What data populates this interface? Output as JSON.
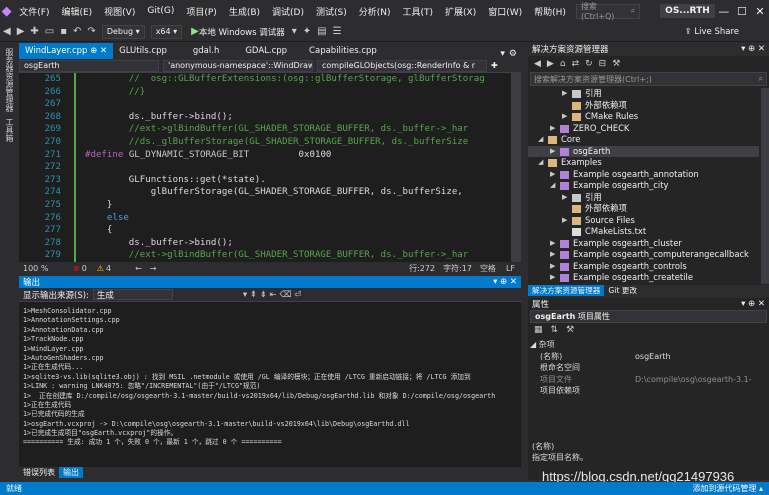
{
  "menu": {
    "items": [
      "文件(F)",
      "编辑(E)",
      "视图(V)",
      "Git(G)",
      "项目(P)",
      "生成(B)",
      "调试(D)",
      "测试(S)",
      "分析(N)",
      "工具(T)",
      "扩展(X)",
      "窗口(W)",
      "帮助(H)"
    ],
    "search_placeholder": "搜索 (Ctrl+Q)",
    "project_badge": "OS...RTH",
    "minimize": "—",
    "maximize": "☐",
    "close": "✕"
  },
  "toolbar": {
    "config": "Debug",
    "platform": "x64",
    "run_label": "本地 Windows 调试器",
    "live_share": "Live Share"
  },
  "left_strip": {
    "labels": [
      "服务器资源管理器",
      "工具箱"
    ]
  },
  "tabs": [
    {
      "label": "WindLayer.cpp",
      "active": false
    },
    {
      "label": "GLUtils.cpp",
      "active": false
    },
    {
      "label": "gdal.h",
      "active": false
    },
    {
      "label": "GDAL.cpp",
      "active": false
    },
    {
      "label": "Capabilities.cpp",
      "active": false
    }
  ],
  "navbar": {
    "project": "osgEarth",
    "scope": "'anonymous-namespace'::WindDrawab",
    "member": "compileGLObjects(osg::RenderInfo & r"
  },
  "code": [
    {
      "n": "265",
      "segs": [
        {
          "t": "        //  osg::GLBufferExtensions:(osg::glBufferStorage, glBufferStorag",
          "c": "c-cm"
        }
      ]
    },
    {
      "n": "266",
      "segs": [
        {
          "t": "        //}",
          "c": "c-cm"
        }
      ]
    },
    {
      "n": "267",
      "segs": [
        {
          "t": "",
          "c": "c-id"
        }
      ]
    },
    {
      "n": "268",
      "segs": [
        {
          "t": "        ds._buffer->bind();",
          "c": "c-id"
        }
      ]
    },
    {
      "n": "269",
      "segs": [
        {
          "t": "        //ext->glBindBuffer(GL_SHADER_STORAGE_BUFFER, ds._buffer->_har",
          "c": "c-cm"
        }
      ]
    },
    {
      "n": "270",
      "segs": [
        {
          "t": "        //ds._glBufferStorage(GL_SHADER_STORAGE_BUFFER, ds._bufferSize",
          "c": "c-cm"
        }
      ]
    },
    {
      "n": "271",
      "segs": [
        {
          "t": "#define ",
          "c": "c-mac"
        },
        {
          "t": "GL_DYNAMIC_STORAGE_BIT",
          "c": "c-macn"
        },
        {
          "t": "         0x0100",
          "c": "c-id"
        }
      ]
    },
    {
      "n": "272",
      "segs": [
        {
          "t": "",
          "c": "c-id"
        }
      ]
    },
    {
      "n": "273",
      "segs": [
        {
          "t": "        GLFunctions::get(*state).",
          "c": "c-id"
        }
      ]
    },
    {
      "n": "274",
      "segs": [
        {
          "t": "            glBufferStorage(GL_SHADER_STORAGE_BUFFER, ds._bufferSize,",
          "c": "c-id"
        }
      ]
    },
    {
      "n": "275",
      "segs": [
        {
          "t": "    }",
          "c": "c-id"
        }
      ]
    },
    {
      "n": "276",
      "segs": [
        {
          "t": "    else",
          "c": "c-kw"
        }
      ]
    },
    {
      "n": "277",
      "segs": [
        {
          "t": "    {",
          "c": "c-id"
        }
      ]
    },
    {
      "n": "278",
      "segs": [
        {
          "t": "        ds._buffer->bind();",
          "c": "c-id"
        }
      ]
    },
    {
      "n": "279",
      "segs": [
        {
          "t": "        //ext->glBindBuffer(GL_SHADER_STORAGE_BUFFER, ds._buffer->_har",
          "c": "c-cm"
        }
      ]
    }
  ],
  "editor_status": {
    "zoom": "100 %",
    "errors": "0",
    "warnings": "4",
    "line": "行:272",
    "char": "字符:17",
    "ws": "空格",
    "eol": "LF"
  },
  "output": {
    "title": "输出",
    "source_label": "显示输出来源(S):",
    "source_value": "生成",
    "lines": [
      "1>MeshConsolidator.cpp",
      "1>AnnotationSettings.cpp",
      "1>AnnotationData.cpp",
      "1>TrackNode.cpp",
      "1>WindLayer.cpp",
      "1>AutoGenShaders.cpp",
      "1>正在生成代码...",
      "1>sqlite3-vs.lib(sqlite3.obj) : 找到 MSIL .netmodule 或使用 /GL 编译的模块；正在使用 /LTCG 重新启动链接；将 /LTCG 添加到",
      "1>LINK : warning LNK4075: 忽略\"/INCREMENTAL\"(由于\"/LTCG\"规范)",
      "1>  正在创建库 D:/compile/osg/osgearth-3.1-master/build-vs2019x64/lib/Debug/osgEarthd.lib 和对象 D:/compile/osg/osgearth",
      "1>正在生成代码",
      "1>已完成代码的生成",
      "1>osgEarth.vcxproj -> D:\\compile\\osg\\osgearth-3.1-master\\build-vs2019x64\\lib\\Debug\\osgEarthd.dll",
      "1>已完成生成项目\"osgEarth.vcxproj\"的操作。",
      "========== 生成: 成功 1 个，失败 0 个，最新 1 个，跳过 0 个 =========="
    ]
  },
  "bottom_tabs": [
    "错误列表",
    "输出"
  ],
  "solution": {
    "title": "解决方案资源管理器",
    "search_placeholder": "搜索解决方案资源管理器(Ctrl+;)",
    "tree": [
      {
        "label": "引用",
        "indent": 3,
        "arrow": "▶",
        "icon": "ref"
      },
      {
        "label": "外部依赖项",
        "indent": 3,
        "arrow": "",
        "icon": "ext"
      },
      {
        "label": "CMake Rules",
        "indent": 3,
        "arrow": "▶",
        "icon": "folder"
      },
      {
        "label": "ZERO_CHECK",
        "indent": 2,
        "arrow": "▶",
        "icon": "proj"
      },
      {
        "label": "Core",
        "indent": 1,
        "arrow": "◢",
        "icon": "folder"
      },
      {
        "label": "osgEarth",
        "indent": 2,
        "arrow": "▶",
        "icon": "proj",
        "selected": true
      },
      {
        "label": "Examples",
        "indent": 1,
        "arrow": "◢",
        "icon": "folder"
      },
      {
        "label": "Example osgearth_annotation",
        "indent": 2,
        "arrow": "▶",
        "icon": "proj"
      },
      {
        "label": "Example osgearth_city",
        "indent": 2,
        "arrow": "◢",
        "icon": "proj"
      },
      {
        "label": "引用",
        "indent": 3,
        "arrow": "▶",
        "icon": "ref"
      },
      {
        "label": "外部依赖项",
        "indent": 3,
        "arrow": "",
        "icon": "ext"
      },
      {
        "label": "Source Files",
        "indent": 3,
        "arrow": "▶",
        "icon": "folder"
      },
      {
        "label": "CMakeLists.txt",
        "indent": 3,
        "arrow": "",
        "icon": "file"
      },
      {
        "label": "Example osgearth_cluster",
        "indent": 2,
        "arrow": "▶",
        "icon": "proj"
      },
      {
        "label": "Example osgearth_computerangecallback",
        "indent": 2,
        "arrow": "▶",
        "icon": "proj"
      },
      {
        "label": "Example osgearth_controls",
        "indent": 2,
        "arrow": "▶",
        "icon": "proj"
      },
      {
        "label": "Example osgearth_createtile",
        "indent": 2,
        "arrow": "▶",
        "icon": "proj"
      }
    ],
    "tabs": [
      "解决方案资源管理器",
      "Git 更改"
    ]
  },
  "properties": {
    "title": "属性",
    "object": "osgEarth",
    "object_kind": "项目属性",
    "category": "杂项",
    "rows": [
      {
        "k": "(名称)",
        "v": "osgEarth",
        "dim": false
      },
      {
        "k": "根命名空间",
        "v": "",
        "dim": false
      },
      {
        "k": "项目文件",
        "v": "D:\\compile\\osg\\osgearth-3.1-",
        "dim": true
      },
      {
        "k": "项目依赖项",
        "v": "",
        "dim": false
      }
    ],
    "desc_title": "(名称)",
    "desc_text": "指定项目名称。"
  },
  "watermark": "https://blog.csdn.net/qq21497936",
  "status": {
    "left": "就绪",
    "right": "添加到源代码管理"
  }
}
